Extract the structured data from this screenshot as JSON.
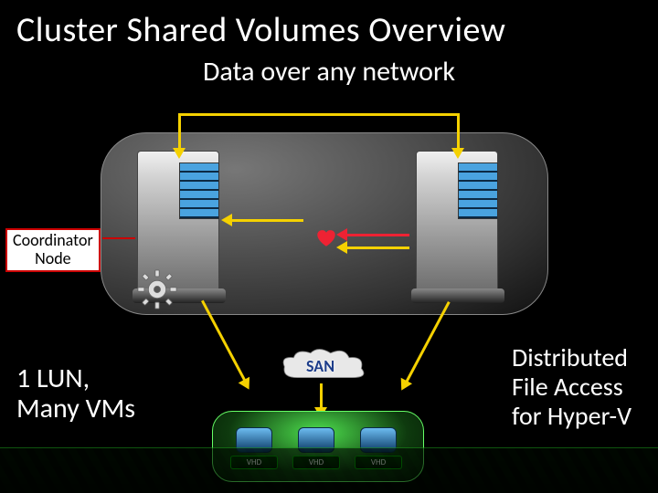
{
  "title": "Cluster Shared Volumes Overview",
  "subtitle": "Data over any network",
  "coordinator_label_line1": "Coordinator",
  "coordinator_label_line2": "Node",
  "san_label": "SAN",
  "vhd": {
    "a": "VHD",
    "b": "VHD",
    "c": "VHD"
  },
  "text_left_line1": "1 LUN,",
  "text_left_line2": "Many VMs",
  "text_right_line1": "Distributed",
  "text_right_line2": "File Access",
  "text_right_line3": "for Hyper-V",
  "colors": {
    "arrow_yellow": "#f5d100",
    "arrow_red": "#e23",
    "coord_border": "#c00",
    "san_text": "#1d3d8a",
    "green_accent": "#1a8a1a"
  },
  "icons": {
    "heart": "heart-icon",
    "gear": "gear-icon",
    "cloud": "cloud-icon",
    "server_left": "server-icon",
    "server_right": "server-icon",
    "disk": "disk-icon"
  }
}
